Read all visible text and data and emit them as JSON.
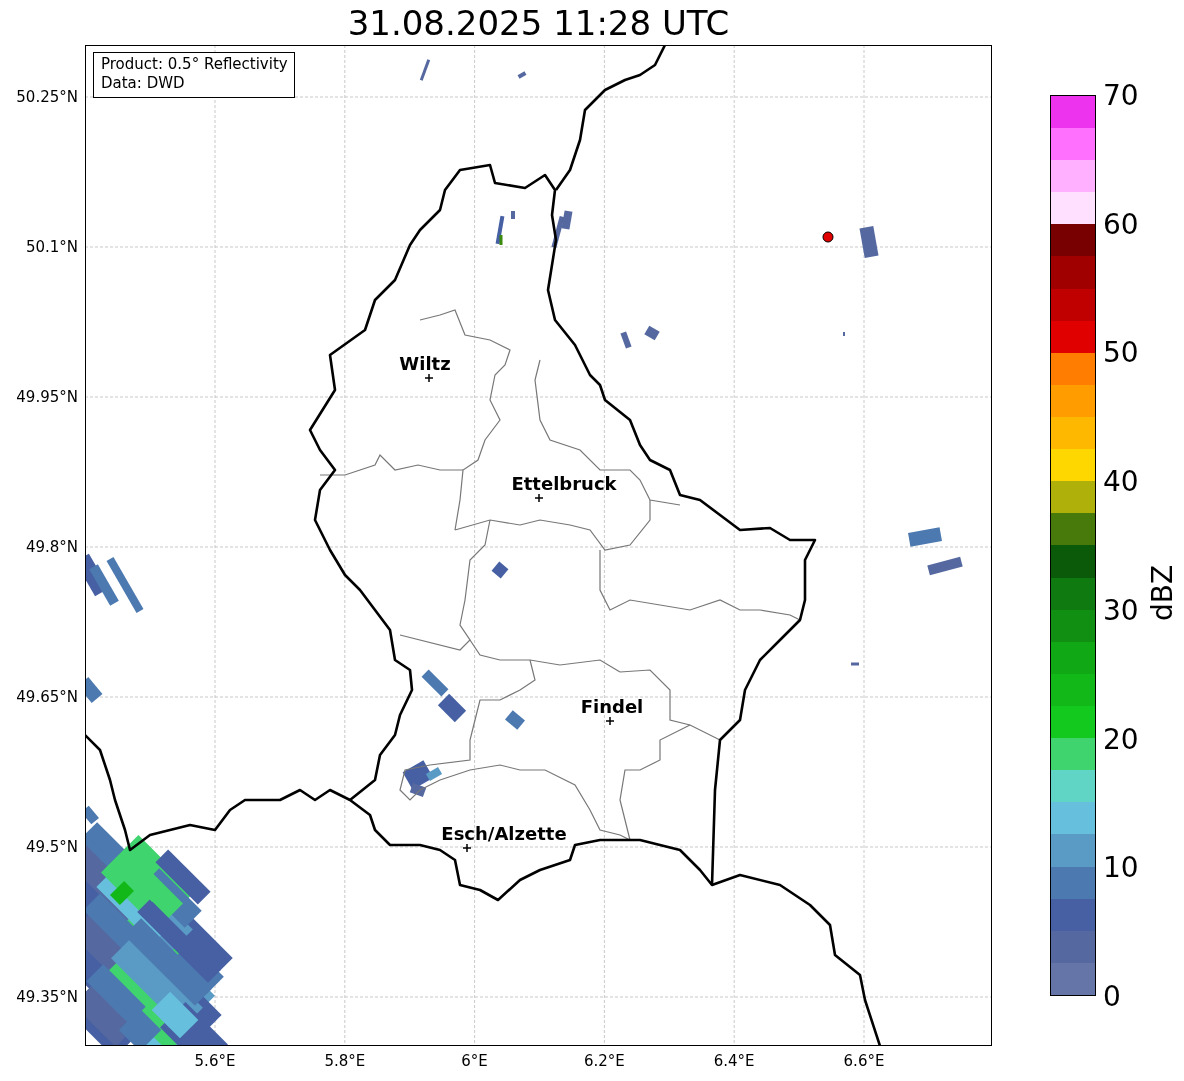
{
  "title": "31.08.2025 11:28 UTC",
  "info_box": {
    "lines": [
      "Product: 0.5° Reflectivity",
      "Data: DWD"
    ]
  },
  "lat_ticks": [
    "50.25°N",
    "50.1°N",
    "49.95°N",
    "49.8°N",
    "49.65°N",
    "49.5°N",
    "49.35°N"
  ],
  "lon_ticks": [
    "5.6°E",
    "5.8°E",
    "6°E",
    "6.2°E",
    "6.4°E",
    "6.6°E"
  ],
  "cities": [
    {
      "name": "Wiltz"
    },
    {
      "name": "Ettelbruck"
    },
    {
      "name": "Findel"
    },
    {
      "name": "Esch/Alzette"
    }
  ],
  "colorbar": {
    "label": "dBZ",
    "ticks": [
      "70",
      "60",
      "50",
      "40",
      "30",
      "20",
      "10",
      "0"
    ],
    "bins": [
      {
        "color": "#6675a8"
      },
      {
        "color": "#5568a0"
      },
      {
        "color": "#4660a3"
      },
      {
        "color": "#4b79b0"
      },
      {
        "color": "#5a9bc6"
      },
      {
        "color": "#66bfdc"
      },
      {
        "color": "#60d5c5"
      },
      {
        "color": "#40d46e"
      },
      {
        "color": "#14c91e"
      },
      {
        "color": "#12b818"
      },
      {
        "color": "#11a815"
      },
      {
        "color": "#108f12"
      },
      {
        "color": "#0f7a10"
      },
      {
        "color": "#0a5a0a"
      },
      {
        "color": "#477a0a"
      },
      {
        "color": "#b0b00a"
      },
      {
        "color": "#ffd700"
      },
      {
        "color": "#ffb800"
      },
      {
        "color": "#ff9d00"
      },
      {
        "color": "#ff7d00"
      },
      {
        "color": "#e00000"
      },
      {
        "color": "#c00000"
      },
      {
        "color": "#a00000"
      },
      {
        "color": "#780000"
      },
      {
        "color": "#ffe0ff"
      },
      {
        "color": "#ffb0ff"
      },
      {
        "color": "#ff70ff"
      },
      {
        "color": "#ee33ee"
      }
    ]
  }
}
